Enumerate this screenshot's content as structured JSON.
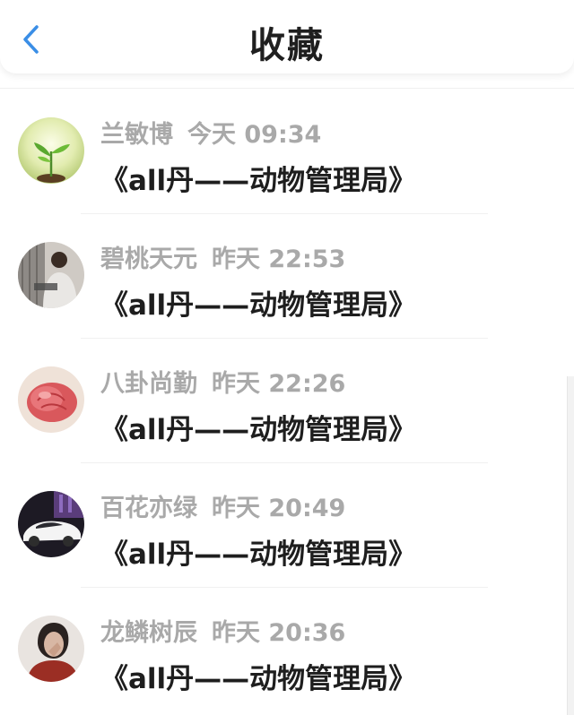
{
  "header": {
    "title": "收藏",
    "back_icon": "chevron-left-icon",
    "accent_color": "#3a8ee6"
  },
  "items": [
    {
      "name": "兰敏博",
      "time": "今天 09:34",
      "message": "《all丹——动物管理局》",
      "avatar": "sprout-avatar"
    },
    {
      "name": "碧桃天元",
      "time": "昨天 22:53",
      "message": "《all丹——动物管理局》",
      "avatar": "person-avatar"
    },
    {
      "name": "八卦尚勤",
      "time": "昨天 22:26",
      "message": "《all丹——动物管理局》",
      "avatar": "rose-avatar"
    },
    {
      "name": "百花亦绿",
      "time": "昨天 20:49",
      "message": "《all丹——动物管理局》",
      "avatar": "car-avatar"
    },
    {
      "name": "龙鳞树辰",
      "time": "昨天 20:36",
      "message": "《all丹——动物管理局》",
      "avatar": "portrait-avatar"
    }
  ]
}
